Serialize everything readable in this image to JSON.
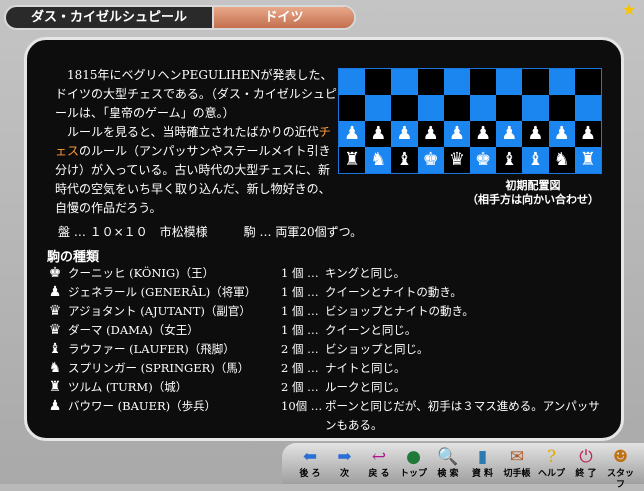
{
  "header": {
    "title": "ダス・カイゼルシュピール",
    "country": "ドイツ"
  },
  "intro": {
    "p1": "1815年にベグリヘンPEGULIHENが発表した、ドイツの大型チェスである。（ダス・カイゼルシュピールは、「皇帝のゲーム」の意。）",
    "p2_a": "ルールを見ると、当時確立されたばかりの近代",
    "p2_highlight": "チェス",
    "p2_b": "のルール（アンパッサンやステールメイト引き分け）が入っている。古い時代の大型チェスに、新時代の空気をいち早く取り込んだ、新し物好きの、自慢の作品だろう。"
  },
  "board": {
    "rows": [
      [
        "",
        "",
        "",
        "",
        "",
        "",
        "",
        "",
        "",
        ""
      ],
      [
        "",
        "",
        "",
        "",
        "",
        "",
        "",
        "",
        "",
        ""
      ],
      [
        "♟",
        "♟",
        "♟",
        "♟",
        "♟",
        "♟",
        "♟",
        "♟",
        "♟",
        "♟"
      ],
      [
        "♜",
        "♞",
        "♝",
        "♚",
        "♛",
        "♚",
        "♝",
        "♝",
        "♞",
        "♜"
      ]
    ],
    "caption_line1": "初期配置図",
    "caption_line2": "（相手方は向かい合わせ）"
  },
  "spec": "盤 … １０×１０　市松模様　　　駒 … 両軍20個ずつ。",
  "pieces": {
    "heading": "駒の種類",
    "items": [
      {
        "icon": "♚",
        "icon_name": "king-icon",
        "name": "クーニッヒ (KÖNIG)（王）",
        "count": "1 個 …",
        "desc": "キングと同じ。"
      },
      {
        "icon": "♟",
        "icon_name": "general-icon",
        "name": "ジェネラール (GENERÂL)（将軍）",
        "count": "1 個 …",
        "desc": "クイーンとナイトの動き。"
      },
      {
        "icon": "♛",
        "icon_name": "adjutant-icon",
        "name": "アジョタント (AJUTANT)（副官）",
        "count": "1 個 …",
        "desc": "ビショップとナイトの動き。"
      },
      {
        "icon": "♛",
        "icon_name": "queen-icon",
        "name": "ダーマ (DAMA)（女王）",
        "count": "1 個 …",
        "desc": "クイーンと同じ。"
      },
      {
        "icon": "♝",
        "icon_name": "bishop-icon",
        "name": "ラウファー (LAUFER)（飛脚）",
        "count": "2 個 …",
        "desc": "ビショップと同じ。"
      },
      {
        "icon": "♞",
        "icon_name": "knight-icon",
        "name": "スプリンガー (SPRINGER)（馬）",
        "count": "2 個 …",
        "desc": "ナイトと同じ。"
      },
      {
        "icon": "♜",
        "icon_name": "rook-icon",
        "name": "ツルム (TURM)（城）",
        "count": "2 個 …",
        "desc": "ルークと同じ。"
      },
      {
        "icon": "♟",
        "icon_name": "pawn-icon",
        "name": "バウワー (BAUER)（歩兵）",
        "count": "10個 …",
        "desc": "ポーンと同じだが、初手は３マス進める。アンパッサンもある。"
      }
    ]
  },
  "toolbar": {
    "buttons": [
      {
        "label": "後 ろ",
        "icon": "⬅",
        "color": "#2a6fd6",
        "name": "back-button",
        "icon_name": "arrow-left-icon"
      },
      {
        "label": "次",
        "icon": "➡",
        "color": "#2a6fd6",
        "name": "next-button",
        "icon_name": "arrow-right-icon"
      },
      {
        "label": "戻 る",
        "icon": "↩",
        "color": "#b0148c",
        "name": "return-button",
        "icon_name": "return-arrow-icon"
      },
      {
        "label": "トップ",
        "icon": "●",
        "color": "#1f7a3a",
        "name": "top-button",
        "icon_name": "globe-icon"
      },
      {
        "label": "検 索",
        "icon": "🔍",
        "color": "#1a5fb0",
        "name": "search-button",
        "icon_name": "magnifier-icon"
      },
      {
        "label": "資 料",
        "icon": "▮",
        "color": "#2b7bb0",
        "name": "materials-button",
        "icon_name": "book-icon"
      },
      {
        "label": "切手帳",
        "icon": "✉",
        "color": "#b05a2a",
        "name": "stamp-book-button",
        "icon_name": "stamp-icon"
      },
      {
        "label": "ヘルプ",
        "icon": "?",
        "color": "#e0a800",
        "name": "help-button",
        "icon_name": "question-icon"
      },
      {
        "label": "終 了",
        "icon": "⏻",
        "color": "#c0205a",
        "name": "quit-button",
        "icon_name": "power-icon"
      },
      {
        "label": "スタッフ",
        "icon": "☻",
        "color": "#c07010",
        "name": "staff-button",
        "icon_name": "staff-icon"
      }
    ]
  },
  "colors": {
    "panel_bg": "#0d0d0d",
    "board_light": "#1b86f0",
    "board_dark": "#000000",
    "highlight": "#ff9a3a",
    "tab_accent": "#c36f4e"
  }
}
